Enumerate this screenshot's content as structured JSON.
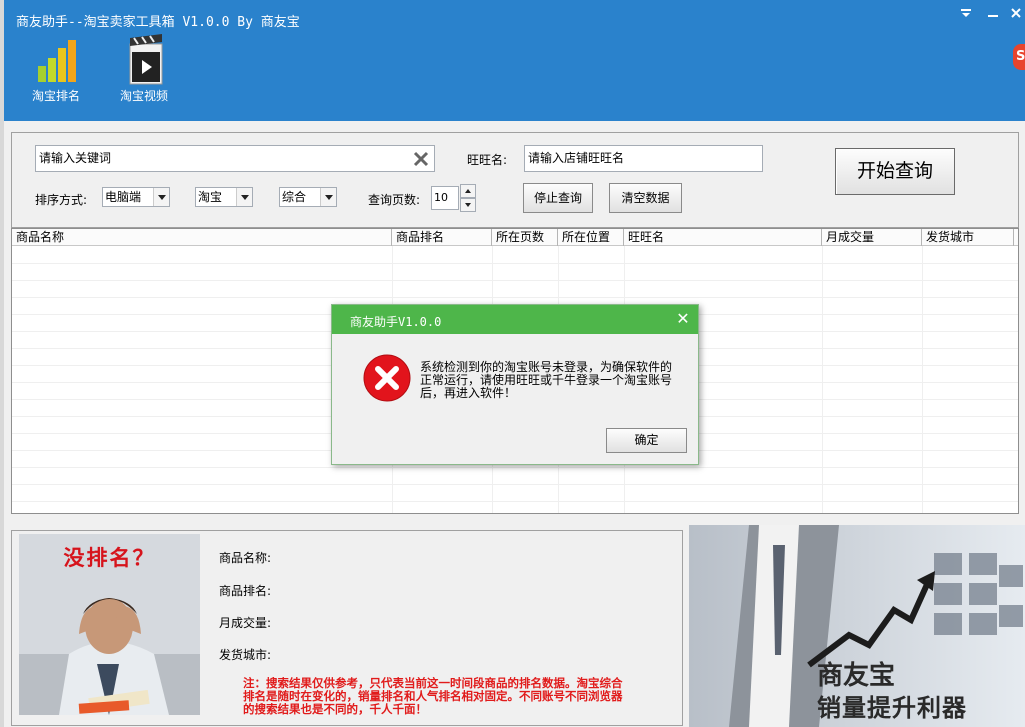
{
  "window": {
    "title": "商友助手--淘宝卖家工具箱 V1.0.0 By 商友宝",
    "controls": [
      "menu-icon",
      "minimize-icon",
      "close-icon"
    ]
  },
  "toolbar": {
    "items": [
      {
        "label": "淘宝排名",
        "icon": "bar-chart-icon"
      },
      {
        "label": "淘宝视频",
        "icon": "clapperboard-icon"
      }
    ]
  },
  "search": {
    "keyword_placeholder": "请输入关键词",
    "wangwang_label": "旺旺名:",
    "shop_placeholder": "请输入店铺旺旺名",
    "sort_label": "排序方式:",
    "sort_options": [
      "电脑端",
      "淘宝",
      "综合"
    ],
    "pages_label": "查询页数:",
    "pages_value": "10",
    "stop_label": "停止查询",
    "clear_label": "清空数据",
    "start_label": "开始查询"
  },
  "table": {
    "columns": [
      "商品名称",
      "商品排名",
      "所在页数",
      "所在位置",
      "旺旺名",
      "月成交量",
      "发货城市"
    ]
  },
  "detail": {
    "banner_text": "没排名？",
    "fields": [
      "商品名称:",
      "商品排名:",
      "月成交量:",
      "发货城市:"
    ],
    "note": "注：搜索结果仅供参考，只代表当前这一时间段商品的排名数据。淘宝综合排名是随时在变化的，销量排名和人气排名相对固定。不同账号不同浏览器的搜索结果也是不同的，千人千面！"
  },
  "promo": {
    "brand": "商友宝",
    "slogan": "销量提升利器"
  },
  "dialog": {
    "title": "商友助手V1.0.0",
    "message": "系统检测到你的淘宝账号未登录，为确保软件的正常运行，请使用旺旺或千牛登录一个淘宝账号后，再进入软件！",
    "ok_label": "确定",
    "icon": "error-icon"
  },
  "colors": {
    "header": "#2a82cc",
    "dialog_title": "#4eb64a",
    "error_red": "#e2141c",
    "note_red": "#e11b1b"
  }
}
